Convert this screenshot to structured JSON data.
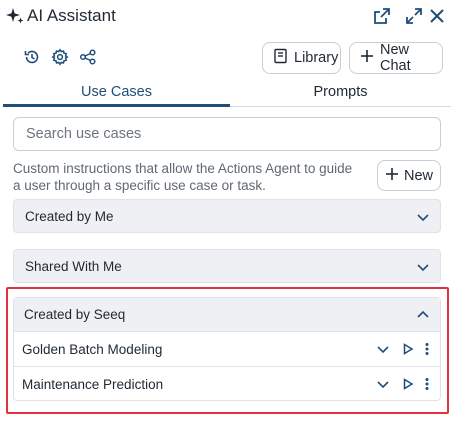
{
  "window": {
    "title": "AI Assistant",
    "sparkle_icon": "sparkle-icon",
    "popout_icon": "popout-icon",
    "expand_icon": "expand-icon",
    "close_icon": "close-icon"
  },
  "toolbar": {
    "history_icon": "history-icon",
    "settings_icon": "gear-icon",
    "share_icon": "share-icon",
    "library_label": "Library",
    "new_chat_label": "New Chat"
  },
  "tabs": [
    {
      "label": "Use Cases",
      "active": true
    },
    {
      "label": "Prompts",
      "active": false
    }
  ],
  "search": {
    "placeholder": "Search use cases",
    "value": ""
  },
  "description": "Custom instructions that allow the Actions Agent to guide a user through a specific use case or task.",
  "new_button_label": "New",
  "sections": [
    {
      "label": "Created by Me",
      "expanded": false
    },
    {
      "label": "Shared With Me",
      "expanded": false
    },
    {
      "label": "Created by Seeq",
      "expanded": true,
      "items": [
        {
          "label": "Golden Batch Modeling"
        },
        {
          "label": "Maintenance Prediction"
        }
      ]
    }
  ],
  "colors": {
    "accent": "#1f4e79",
    "highlight": "#e0313f",
    "section_bg": "#eef0f3"
  }
}
